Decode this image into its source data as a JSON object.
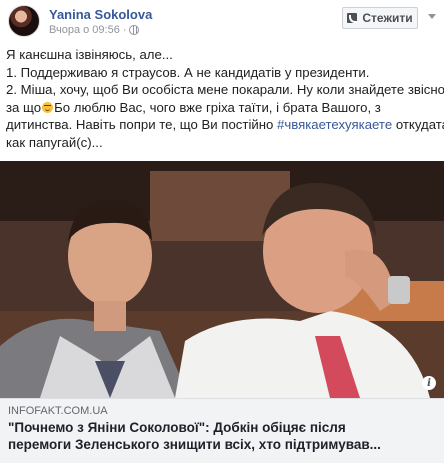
{
  "post": {
    "author": "Yanina Sokolova",
    "time": "Вчора о 09:56",
    "separator": "·",
    "follow_label": "Стежити",
    "lines": [
      "Я канєшна ізвіняюсь, але...",
      "1. Поддерживаю я страусов. А не кандидатів у президенти.",
      "2. Міша, хочу, щоб Ви особіста мене покарали. Ну коли знайдете звісно",
      [
        "за що",
        "Бо люблю Вас, чого вже гріха таїти, і брата Вашого, з"
      ],
      "дитинства. Навіть попри те, що Ви постійно",
      "откудата",
      "как папугай(с)..."
    ],
    "hashtag": "#чвякаетехуякаете"
  },
  "link": {
    "domain": "INFOFAKT.COM.UA",
    "title_line1": "\"Почнемо з Яніни Соколової\": Добкін обіцяє після",
    "title_line2": "перемоги Зеленського знищити всіх, хто підтримував..."
  },
  "icons": {
    "avatar": "avatar",
    "globe": "globe-icon",
    "follow": "rss-icon",
    "menu": "chevron-down-icon",
    "emoji": "smile-emoji-icon",
    "info": "info-icon"
  },
  "colors": {
    "name_link": "#385898",
    "hashtag": "#365899",
    "meta": "#90949c",
    "link_box_bg": "#f2f3f5"
  }
}
